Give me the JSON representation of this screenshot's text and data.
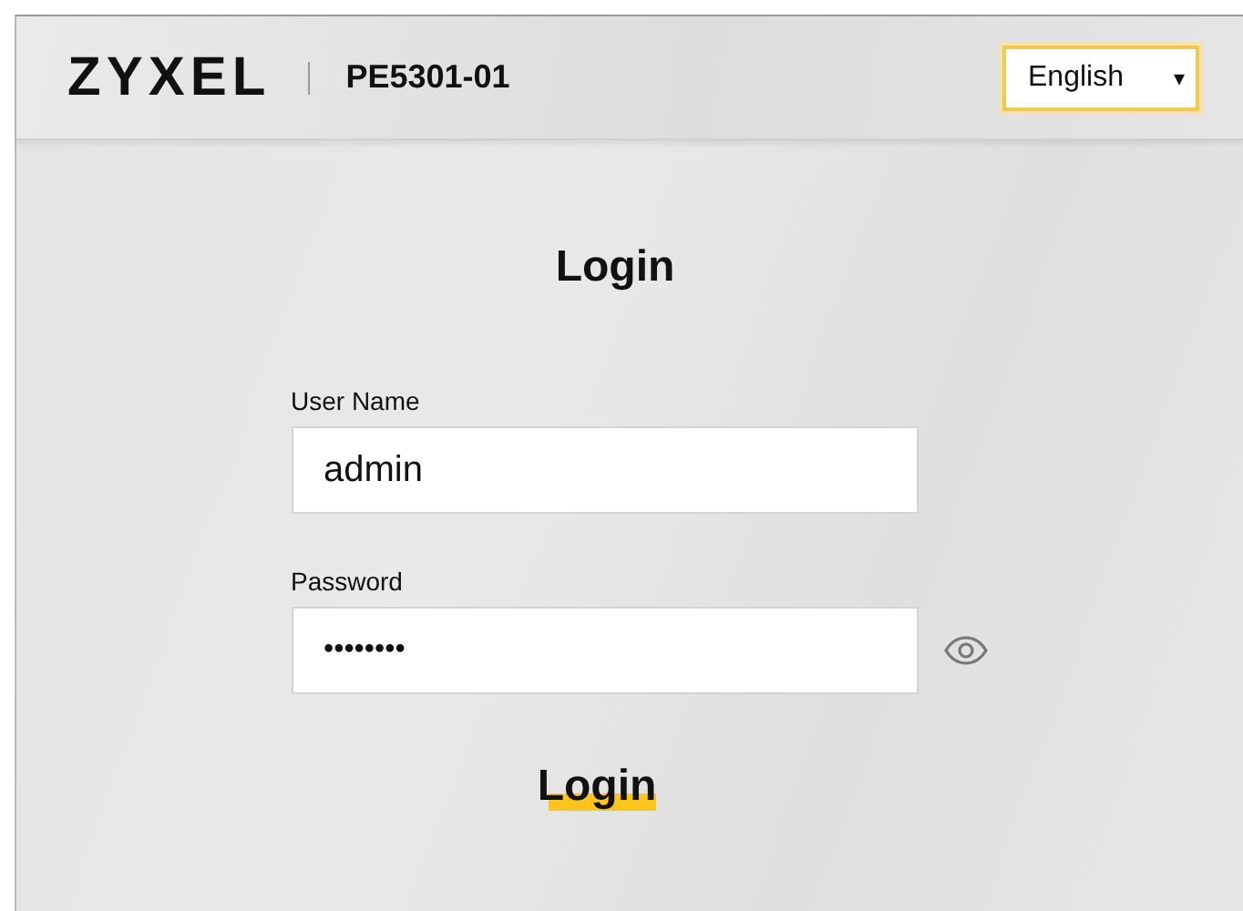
{
  "header": {
    "logo": "ZYXEL",
    "model": "PE5301-01",
    "language": {
      "value": "English",
      "caret": "▾"
    }
  },
  "login": {
    "title": "Login",
    "fields": [
      {
        "kind": "text",
        "label": "User Name",
        "value": "admin"
      },
      {
        "kind": "password",
        "label": "Password",
        "value": "••••••••"
      }
    ],
    "button": "Login"
  }
}
